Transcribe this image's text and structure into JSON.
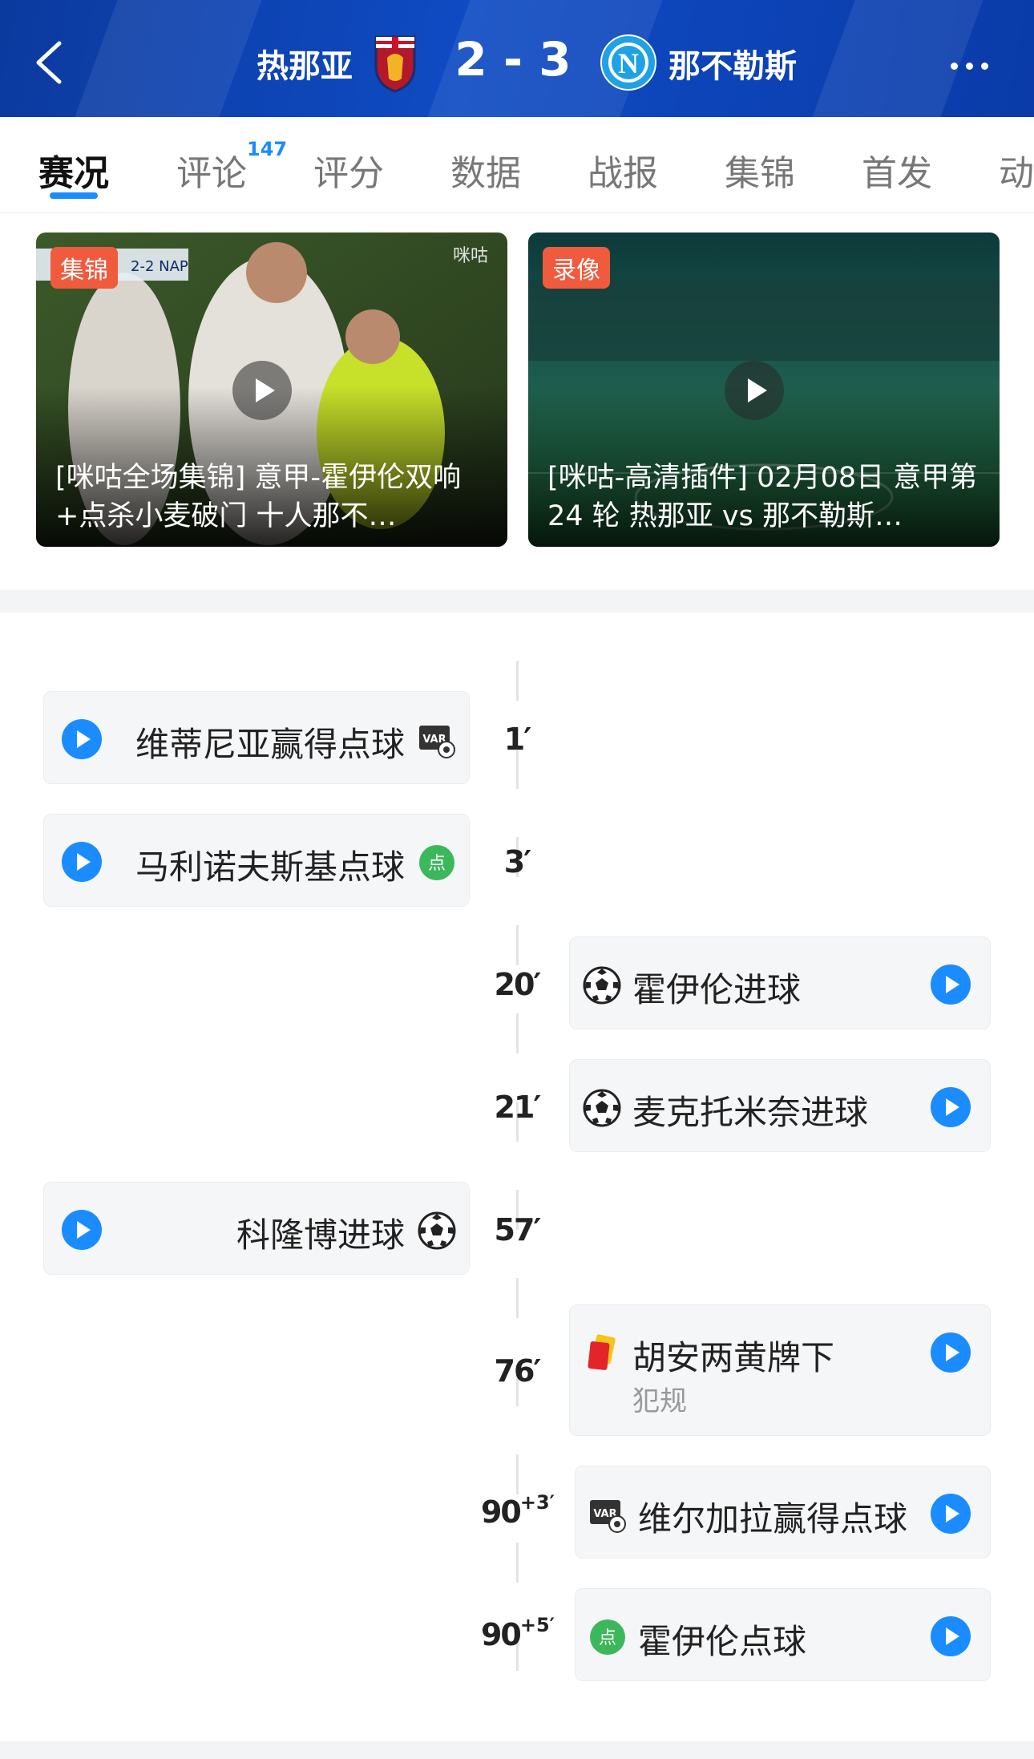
{
  "header": {
    "home_team": "热那亚",
    "away_team": "那不勒斯",
    "score": "2 - 3",
    "colors": {
      "header_bg": "#0f4bc4",
      "accent": "#1a8cff"
    },
    "icons": {
      "back": "chevron-left-icon",
      "more": "more-dots-icon",
      "home_crest": "genoa-crest",
      "away_crest": "napoli-crest"
    },
    "away_crest_letter": "N"
  },
  "tabs": [
    {
      "label": "赛况",
      "active": true
    },
    {
      "label": "评论",
      "badge": "147"
    },
    {
      "label": "评分"
    },
    {
      "label": "数据"
    },
    {
      "label": "战报"
    },
    {
      "label": "集锦"
    },
    {
      "label": "首发"
    },
    {
      "label": "动"
    }
  ],
  "videos": [
    {
      "tag": "集锦",
      "title": "[咪咕全场集锦] 意甲-霍伊伦双响+点杀小麦破门 十人那不…",
      "overlay_text": "咪咕",
      "scoreboard": "2-2 NAP"
    },
    {
      "tag": "录像",
      "title": "[咪咕-高清插件] 02月08日 意甲第 24 轮 热那亚 vs 那不勒斯…"
    }
  ],
  "events": [
    {
      "minute": "1′",
      "side": "home",
      "label": "维蒂尼亚赢得点球",
      "icon": "var-icon"
    },
    {
      "minute": "3′",
      "side": "home",
      "label": "马利诺夫斯基点球",
      "icon": "penalty-goal-icon",
      "icon_text": "点"
    },
    {
      "minute": "20′",
      "side": "away",
      "label": "霍伊伦进球",
      "icon": "football-icon"
    },
    {
      "minute": "21′",
      "side": "away",
      "label": "麦克托米奈进球",
      "icon": "football-icon"
    },
    {
      "minute": "57′",
      "side": "home",
      "label": "科隆博进球",
      "icon": "football-icon"
    },
    {
      "minute": "76′",
      "side": "away",
      "label": "胡安两黄牌下",
      "sub": "犯规",
      "icon": "second-yellow-red-card-icon"
    },
    {
      "minute": "90",
      "extra": "+3′",
      "side": "away",
      "label": "维尔加拉赢得点球",
      "icon": "var-icon"
    },
    {
      "minute": "90",
      "extra": "+5′",
      "side": "away",
      "label": "霍伊伦点球",
      "icon": "penalty-goal-icon",
      "icon_text": "点"
    }
  ],
  "var_text": "VAR"
}
